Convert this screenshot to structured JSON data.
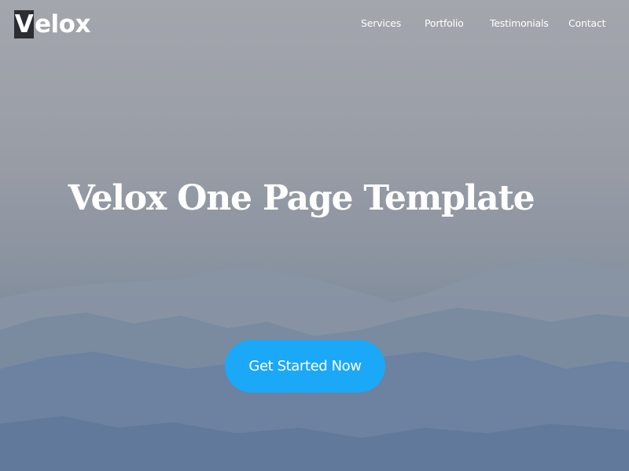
{
  "header": {
    "logo": {
      "initial": "V",
      "rest": "elox"
    },
    "nav": [
      {
        "label": "Services"
      },
      {
        "label": "Portfolio"
      },
      {
        "label": "Testimonials"
      },
      {
        "label": "Contact"
      }
    ]
  },
  "hero": {
    "title": "Velox One Page Template",
    "cta_label": "Get Started Now"
  },
  "colors": {
    "cta": "#1ba8f7",
    "logo_box": "#2b2d33",
    "text": "#ffffff"
  }
}
